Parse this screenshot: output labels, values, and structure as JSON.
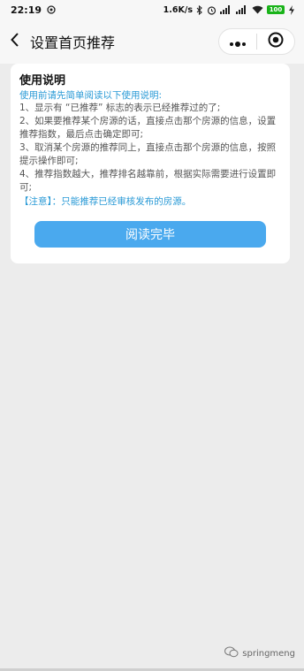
{
  "statusbar": {
    "time": "22:19",
    "net_speed": "1.6K/s",
    "battery": "100"
  },
  "navbar": {
    "title": "设置首页推荐"
  },
  "card": {
    "title": "使用说明",
    "intro": "使用前请先简单阅读以下使用说明:",
    "items": [
      "1、显示有 “已推荐” 标志的表示已经推荐过的了;",
      "2、如果要推荐某个房源的话，直接点击那个房源的信息，设置推荐指数，最后点击确定即可;",
      "3、取消某个房源的推荐同上，直接点击那个房源的信息，按照提示操作即可;",
      "4、推荐指数越大，推荐排名越靠前，根据实际需要进行设置即可;"
    ],
    "note": "【注意】：只能推荐已经审核发布的房源。",
    "button_label": "阅读完毕"
  },
  "watermark": {
    "text": "springmeng"
  },
  "colors": {
    "accent": "#4aa9ee",
    "intro_text": "#2a9ad6",
    "page_bg": "#ececec",
    "battery": "#19b319"
  },
  "icons": [
    "back-arrow-icon",
    "more-dots-icon",
    "close-target-icon",
    "bluetooth-icon",
    "alarm-icon",
    "signal-icon",
    "wifi-icon",
    "charging-icon",
    "wechat-icon"
  ]
}
